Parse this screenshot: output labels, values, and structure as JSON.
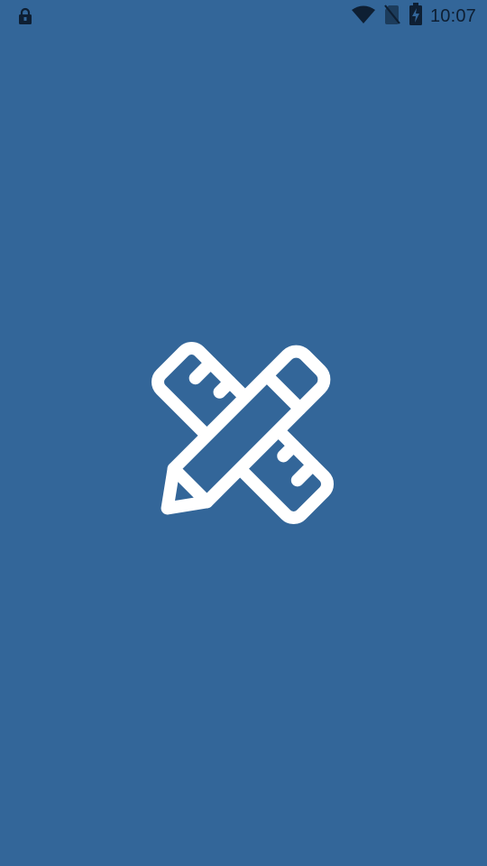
{
  "status_bar": {
    "time": "10:07",
    "icons": [
      "lock-icon",
      "wifi-icon",
      "no-sim-icon",
      "battery-charging-icon"
    ]
  },
  "splash": {
    "logo_icon": "ruler-pencil-icon",
    "background_color": "#336699",
    "icon_color": "#ffffff"
  }
}
